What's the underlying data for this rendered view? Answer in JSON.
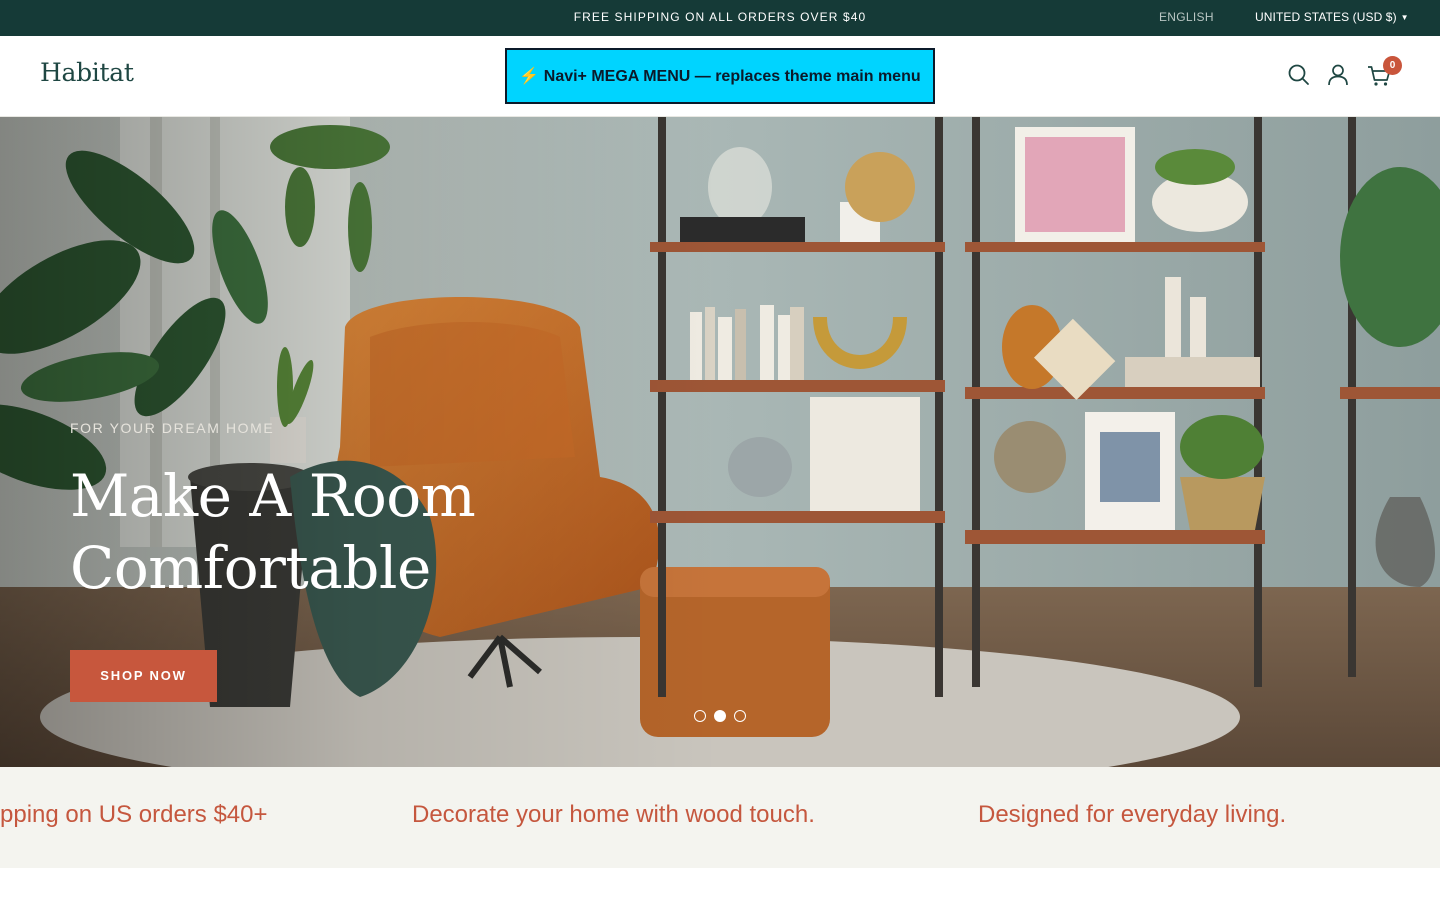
{
  "announcement": {
    "text": "FREE SHIPPING ON ALL ORDERS OVER $40",
    "language": "ENGLISH",
    "country": "UNITED STATES (USD $)"
  },
  "header": {
    "logo": "Habitat",
    "mega_menu": "⚡ Navi+ MEGA MENU — replaces theme main menu",
    "cart_count": "0",
    "icons": [
      "search-icon",
      "account-icon",
      "cart-icon"
    ]
  },
  "hero": {
    "eyebrow": "FOR YOUR DREAM HOME",
    "title": "Make A Room Comfortable",
    "button": "SHOP NOW",
    "slides": 3,
    "active_slide": 2
  },
  "strip": {
    "items": [
      "pping on US orders $40+",
      "Decorate your home with wood touch.",
      "Designed for everyday living."
    ]
  },
  "colors": {
    "announcement_bg": "#153a37",
    "accent": "#c7573d",
    "mega_menu_bg": "#00d4ff",
    "strip_bg": "#f4f4ef"
  }
}
